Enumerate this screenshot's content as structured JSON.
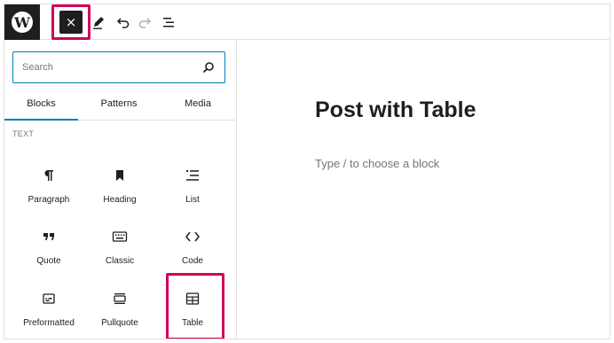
{
  "toolbar": {
    "close_label": "×"
  },
  "sidebar": {
    "search_placeholder": "Search",
    "tabs": [
      {
        "label": "Blocks",
        "active": true
      },
      {
        "label": "Patterns",
        "active": false
      },
      {
        "label": "Media",
        "active": false
      }
    ],
    "section_label": "TEXT",
    "blocks": [
      {
        "label": "Paragraph",
        "icon": "paragraph-icon"
      },
      {
        "label": "Heading",
        "icon": "heading-bookmark-icon"
      },
      {
        "label": "List",
        "icon": "list-icon"
      },
      {
        "label": "Quote",
        "icon": "quote-icon"
      },
      {
        "label": "Classic",
        "icon": "keyboard-icon"
      },
      {
        "label": "Code",
        "icon": "code-icon"
      },
      {
        "label": "Preformatted",
        "icon": "preformatted-icon"
      },
      {
        "label": "Pullquote",
        "icon": "pullquote-icon"
      },
      {
        "label": "Table",
        "icon": "table-icon"
      }
    ]
  },
  "editor": {
    "post_title": "Post with Table",
    "block_placeholder": "Type / to choose a block"
  },
  "colors": {
    "accent": "#007cba",
    "highlight": "#d1005b",
    "dark": "#1e1e1e"
  }
}
